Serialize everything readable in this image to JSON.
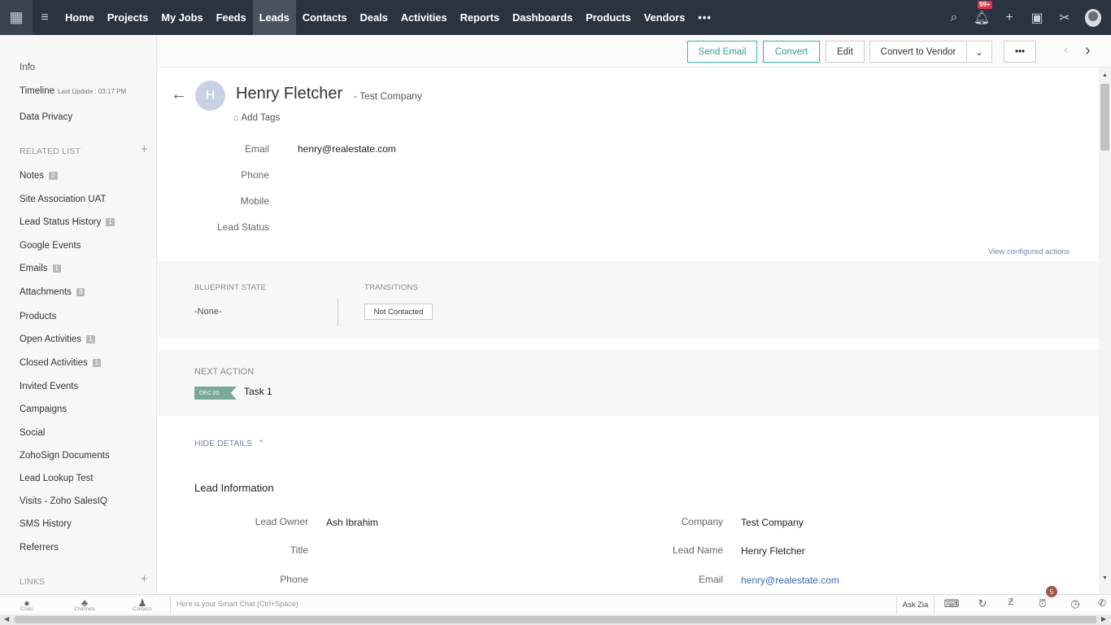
{
  "nav": {
    "tabs": [
      "Home",
      "Projects",
      "My Jobs",
      "Feeds",
      "Leads",
      "Contacts",
      "Deals",
      "Activities",
      "Reports",
      "Dashboards",
      "Products",
      "Vendors"
    ],
    "active_tab": "Leads",
    "more": "•••",
    "notification_badge": "99+",
    "icons": [
      "search-icon",
      "bell-icon",
      "plus-icon",
      "calendar-icon",
      "tools-icon",
      "avatar"
    ]
  },
  "actions": {
    "send_email": "Send Email",
    "convert": "Convert",
    "edit": "Edit",
    "convert_to_vendor": "Convert to Vendor",
    "more": "•••",
    "accent": "#3ab5a0"
  },
  "left": {
    "info": "Info",
    "timeline": "Timeline",
    "timeline_sub": "Last Update : 03:17 PM",
    "data_privacy": "Data Privacy",
    "related_list": "RELATED LIST",
    "items": [
      {
        "label": "Notes",
        "count": "2"
      },
      {
        "label": "Site Association UAT",
        "count": ""
      },
      {
        "label": "Lead Status History",
        "count": "1"
      },
      {
        "label": "Google Events",
        "count": ""
      },
      {
        "label": "Emails",
        "count": "1"
      },
      {
        "label": "Attachments",
        "count": "3"
      },
      {
        "label": "Products",
        "count": ""
      },
      {
        "label": "Open Activities",
        "count": "1"
      },
      {
        "label": "Closed Activities",
        "count": "1"
      },
      {
        "label": "Invited Events",
        "count": ""
      },
      {
        "label": "Campaigns",
        "count": ""
      },
      {
        "label": "Social",
        "count": ""
      },
      {
        "label": "ZohoSign Documents",
        "count": ""
      },
      {
        "label": "Lead Lookup Test",
        "count": ""
      },
      {
        "label": "Visits - Zoho SalesIQ",
        "count": ""
      },
      {
        "label": "SMS History",
        "count": ""
      },
      {
        "label": "Referrers",
        "count": ""
      }
    ],
    "links": "LINKS"
  },
  "record": {
    "avatar_initial": "H",
    "name": "Henry Fletcher",
    "company_suffix": "- Test Company",
    "add_tags": "Add Tags",
    "fields": [
      {
        "label": "Email",
        "value": "henry@realestate.com"
      },
      {
        "label": "Phone",
        "value": ""
      },
      {
        "label": "Mobile",
        "value": ""
      },
      {
        "label": "Lead Status",
        "value": ""
      }
    ],
    "view_configured_actions": "View configured actions"
  },
  "blueprint": {
    "state_label": "BLUEPRINT STATE",
    "state_value": "-None-",
    "transitions_label": "TRANSITIONS",
    "transition_button": "Not Contacted"
  },
  "next_action": {
    "label": "NEXT ACTION",
    "date": "DEC 20",
    "task": "Task 1"
  },
  "details": {
    "hide_details": "HIDE DETAILS",
    "section_title": "Lead Information",
    "left_fields": [
      {
        "label": "Lead Owner",
        "value": "Ash Ibrahim"
      },
      {
        "label": "Title",
        "value": ""
      },
      {
        "label": "Phone",
        "value": ""
      }
    ],
    "right_fields": [
      {
        "label": "Company",
        "value": "Test Company"
      },
      {
        "label": "Lead Name",
        "value": "Henry Fletcher"
      },
      {
        "label": "Email",
        "value": "henry@realestate.com"
      }
    ]
  },
  "bottom": {
    "chats": "Chats",
    "channels": "Channels",
    "contacts": "Contacts",
    "smart_chat": "Here is your Smart Chat (Ctrl+Space)",
    "ask_zia": "Ask Zia",
    "alarm_badge": "5"
  }
}
